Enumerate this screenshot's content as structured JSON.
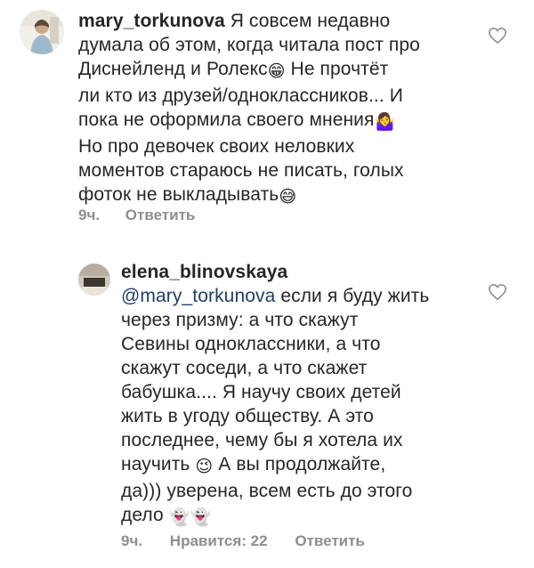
{
  "comments": [
    {
      "username": "mary_torkunova",
      "mention": "",
      "lines": [
        "Я совсем недавно",
        "думала об этом, когда читала пост про",
        "Диснейленд и Ролекс",
        " Не прочтёт",
        "ли кто из друзей/одноклассников... И",
        "пока не оформила своего мнения",
        "Но про девочек  своих неловких",
        "моментов стараюсь не писать, голых",
        "фоток не выкладывать"
      ],
      "emojis": [
        "😁",
        "🤷‍♀️",
        "😅"
      ],
      "time": "9ч.",
      "likes": "",
      "reply_label": "Ответить"
    },
    {
      "username": "elena_blinovskaya",
      "mention": "@mary_torkunova",
      "lines": [
        " если я буду жить",
        "через призму: а что скажут",
        "Севины одноклассники, а что",
        "скажут соседи, а что скажет",
        "бабушка.... Я научу своих детей",
        "жить в угоду обществу. А это",
        "последнее, чему бы я хотела их",
        "научить",
        " А вы продолжайте,",
        "да))) уверена, всем есть до этого",
        "дело"
      ],
      "emojis": [
        "😉",
        "👻",
        "👻"
      ],
      "time": "9ч.",
      "likes": "Нравится: 22",
      "reply_label": "Ответить"
    }
  ],
  "icons": {
    "like": "heart-outline-icon"
  },
  "colors": {
    "text": "#262626",
    "meta": "#8e8e8e",
    "mention": "#1f3f68"
  }
}
